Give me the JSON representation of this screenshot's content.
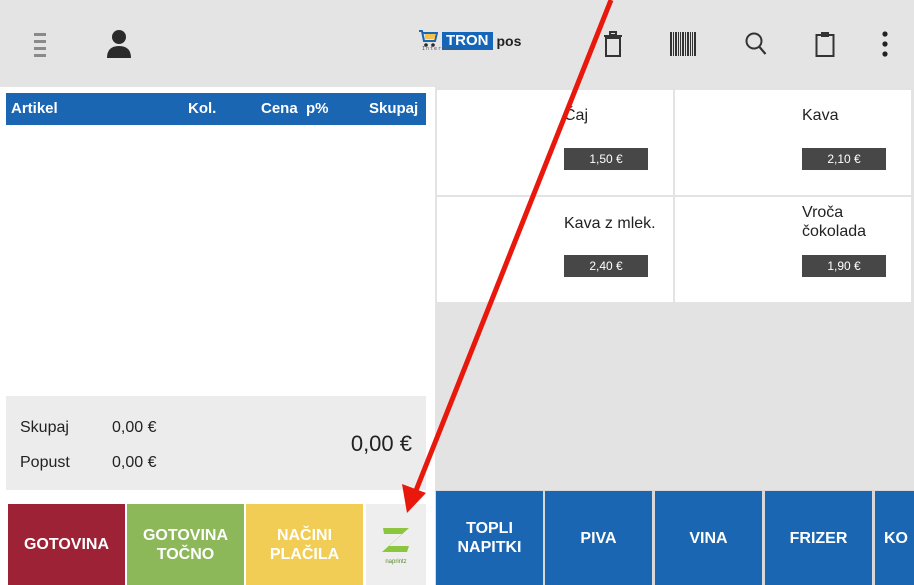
{
  "header": {
    "logo_brand": "TRON",
    "logo_sub": "InterCenter",
    "logo_pos": "pos"
  },
  "receipt": {
    "columns": [
      "Artikel",
      "Kol.",
      "Cena",
      "p%",
      "Skupaj"
    ],
    "total_label": "Skupaj",
    "total_value": "0,00 €",
    "discount_label": "Popust",
    "discount_value": "0,00 €",
    "grand_total": "0,00 €"
  },
  "payment": {
    "cash": "GOTOVINA",
    "cash_exact_1": "GOTOVINA",
    "cash_exact_2": "TOČNO",
    "methods_1": "NAČINI",
    "methods_2": "PLAČILA",
    "naprintz_label": "naprintz"
  },
  "products": [
    {
      "name": "Čaj",
      "price": "1,50 €"
    },
    {
      "name": "Kava",
      "price": "2,10 €"
    },
    {
      "name": "Kava z mlek.",
      "price": "2,40 €"
    },
    {
      "name_1": "Vroča",
      "name_2": "čokolada",
      "price": "1,90 €"
    }
  ],
  "categories": [
    {
      "line1": "TOPLI",
      "line2": "NAPITKI"
    },
    {
      "label": "PIVA"
    },
    {
      "label": "VINA"
    },
    {
      "label": "FRIZER"
    },
    {
      "label": "KO"
    }
  ],
  "colors": {
    "blue": "#1a66b3",
    "cash_red": "#9e2235",
    "cash_exact_green": "#8cb85a",
    "methods_yellow": "#f2cd55",
    "arrow_red": "#e8180c"
  },
  "icons": [
    "menu-icon",
    "user-icon",
    "cart-icon",
    "trash-icon",
    "barcode-icon",
    "search-icon",
    "clipboard-icon",
    "more-vert-icon",
    "naprintz-logo-icon"
  ]
}
